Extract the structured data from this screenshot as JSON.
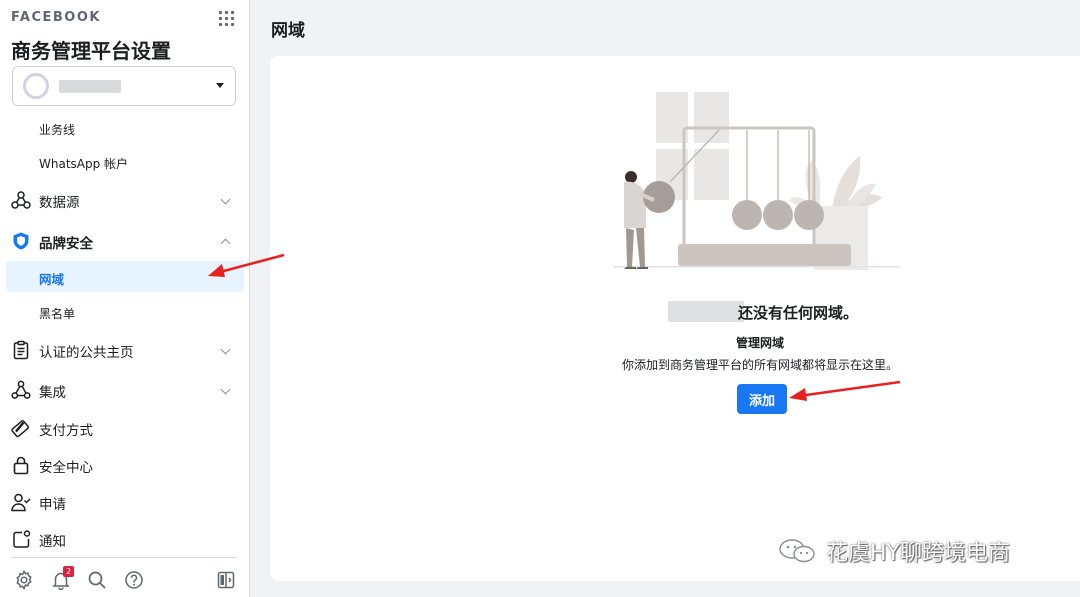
{
  "sidebar": {
    "brand": "FACEBOOK",
    "title": "商务管理平台设置",
    "account_selector_icon": "caret-down-icon",
    "sub_items": [
      "业务线",
      "WhatsApp 帐户"
    ],
    "items": [
      {
        "label": "数据源",
        "icon": "data-sources-icon",
        "chevron": "down"
      },
      {
        "label": "品牌安全",
        "icon": "shield-icon",
        "chevron": "up"
      },
      {
        "label": "认证的公共主页",
        "icon": "clipboard-icon",
        "chevron": "down"
      },
      {
        "label": "集成",
        "icon": "integration-icon",
        "chevron": "down"
      },
      {
        "label": "支付方式",
        "icon": "credit-card-icon"
      },
      {
        "label": "安全中心",
        "icon": "lock-icon"
      },
      {
        "label": "申请",
        "icon": "person-check-icon"
      },
      {
        "label": "通知",
        "icon": "notification-icon"
      }
    ],
    "brand_safety_children": [
      "网域",
      "黑名单"
    ],
    "active_item": "网域",
    "footer": {
      "icons": [
        "settings-icon",
        "bell-icon",
        "search-icon",
        "help-icon",
        "panel-toggle-icon"
      ],
      "notification_count": "2"
    }
  },
  "main": {
    "page_title": "网域",
    "empty_state": {
      "headline": "还没有任何网域。",
      "section_title": "管理网域",
      "description": "你添加到商务管理平台的所有网域都将显示在这里。",
      "add_button": "添加"
    }
  },
  "watermark": {
    "text": "花虞HY聊跨境电商"
  },
  "colors": {
    "accent": "#1877f2",
    "annotation_arrow": "#e8201e",
    "active_bg": "#e7f3ff"
  }
}
